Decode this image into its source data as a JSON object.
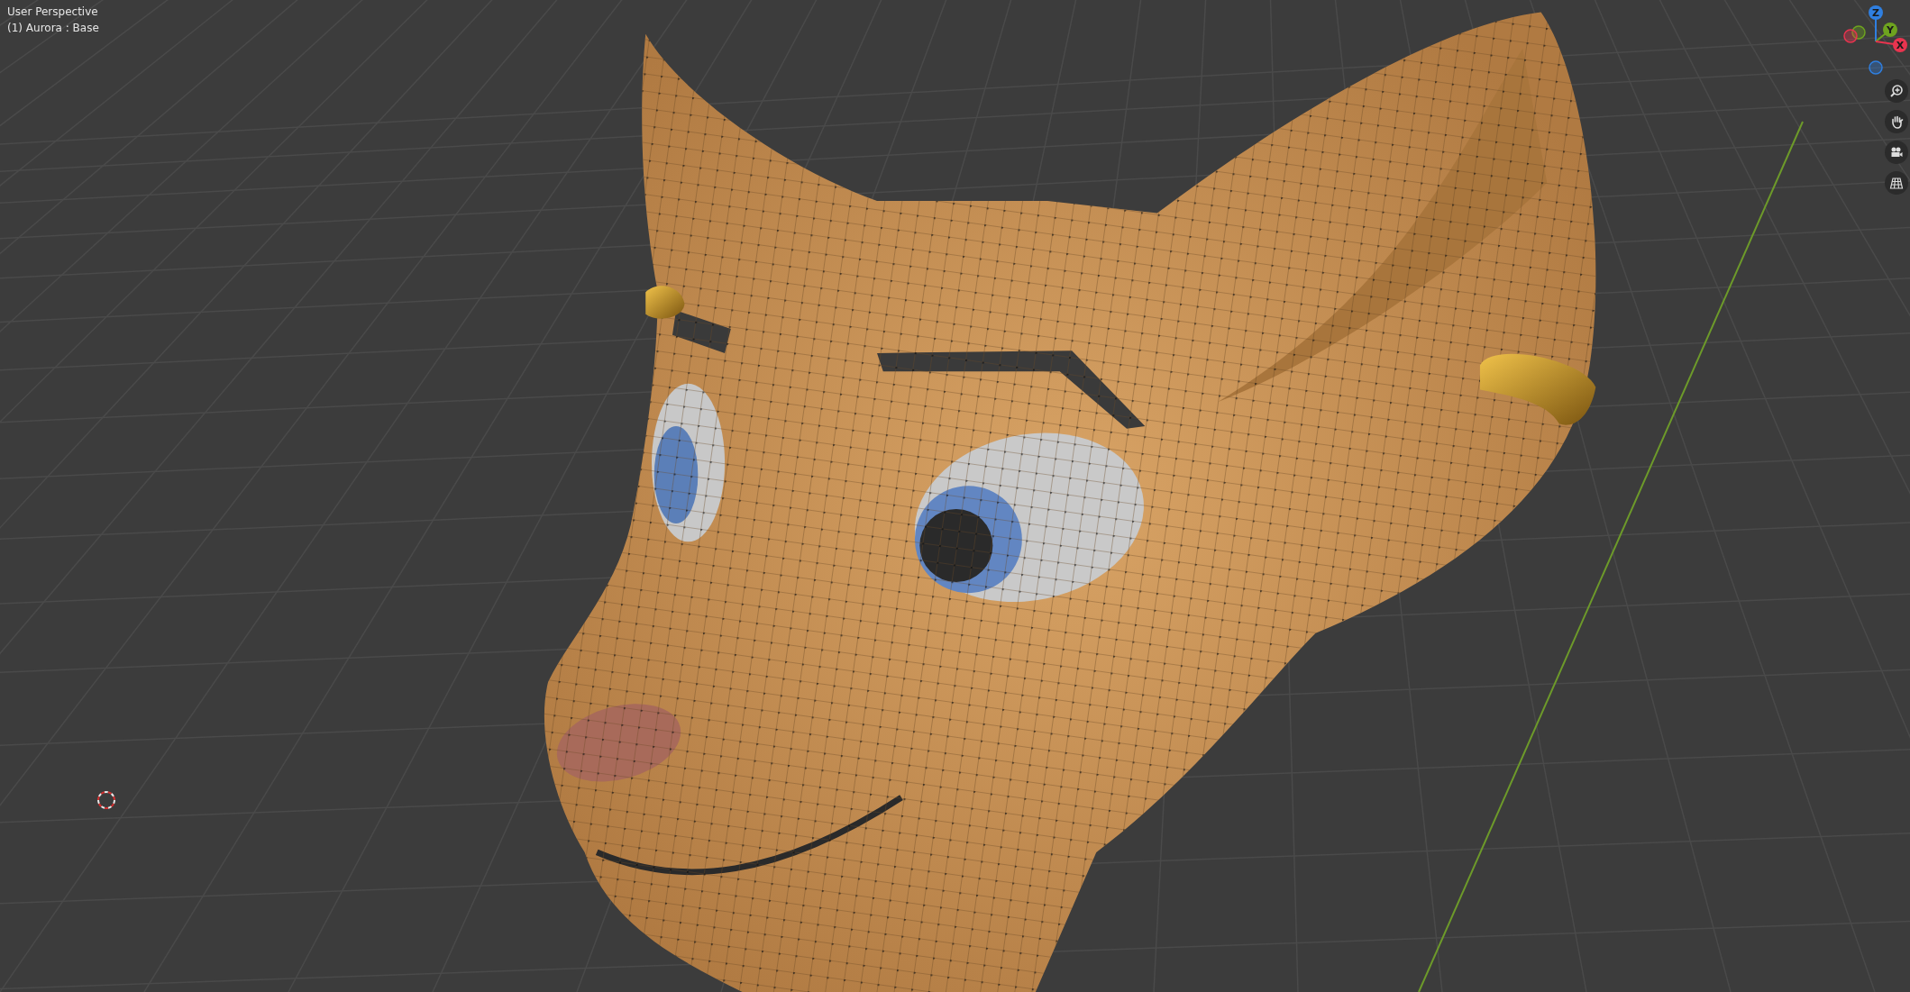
{
  "viewport": {
    "view_name": "User Perspective",
    "object_info": "(1) Aurora : Base"
  },
  "navigation_gizmo": {
    "axes": [
      {
        "label": "Z",
        "color": "#2f7fe0"
      },
      {
        "label": "Y",
        "color": "#6ea31f"
      },
      {
        "label": "X",
        "color": "#e8344f"
      }
    ]
  },
  "navigation_buttons": [
    {
      "kind": "zoom"
    },
    {
      "kind": "pan"
    },
    {
      "kind": "camera"
    },
    {
      "kind": "ortho"
    }
  ]
}
